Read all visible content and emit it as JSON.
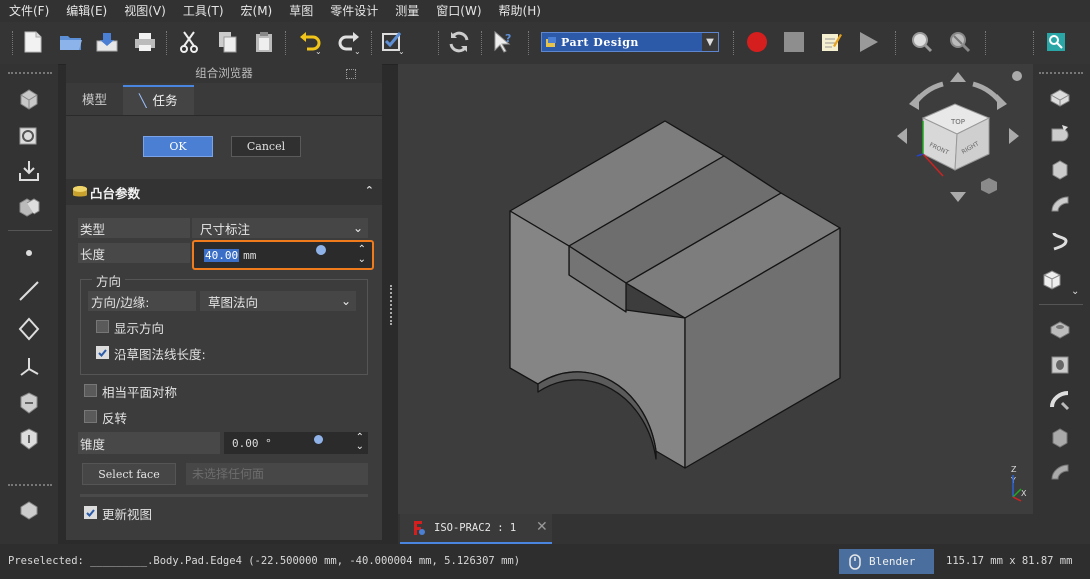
{
  "menu": [
    "文件(F)",
    "编辑(E)",
    "视图(V)",
    "工具(T)",
    "宏(M)",
    "草图",
    "零件设计",
    "测量",
    "窗口(W)",
    "帮助(H)"
  ],
  "toolbar": {
    "workbench": "Part Design",
    "icons": [
      "new-document-icon",
      "open-folder-icon",
      "save-icon",
      "print-icon",
      "cut-icon",
      "copy-icon",
      "paste-icon",
      "undo-icon",
      "redo-icon",
      "check-icon",
      "refresh-icon",
      "whats-this-icon",
      "record-macro-icon",
      "stop-macro-icon",
      "edit-macro-icon",
      "run-macro-icon",
      "measure-icon",
      "measure-settings-icon",
      "zoom-search-icon"
    ],
    "colors": {
      "record": "#d51f1f",
      "workbench_bg": "#2c5aa8"
    }
  },
  "panel": {
    "title": "组合浏览器",
    "tabs": [
      {
        "label": "模型"
      },
      {
        "label": "任务"
      }
    ],
    "ok_label": "OK",
    "cancel_label": "Cancel",
    "section_title": "凸台参数",
    "type_label": "类型",
    "type_value": "尺寸标注",
    "length_label": "长度",
    "length_value": "40.00",
    "length_unit": "mm",
    "direction_group": "方向",
    "direction_edge_label": "方向/边缘:",
    "direction_edge_value": "草图法向",
    "show_direction_label": "显示方向",
    "show_direction_checked": false,
    "along_normal_label": "沿草图法线长度:",
    "along_normal_checked": true,
    "symmetric_label": "相当平面对称",
    "symmetric_checked": false,
    "reversed_label": "反转",
    "reversed_checked": false,
    "taper_label": "锥度",
    "taper_value": "0.00 °",
    "select_face_label": "Select face",
    "face_placeholder": "未选择任何面",
    "update_view_label": "更新视图",
    "update_view_checked": true,
    "highlight_color": "#f07b1c"
  },
  "view_tab": {
    "label": "ISO-PRAC2 : 1"
  },
  "navcube": {
    "faces": [
      "TOP",
      "FRONT",
      "RIGHT"
    ]
  },
  "axis_labels": [
    "Z",
    "Y",
    "X"
  ],
  "status": {
    "preselected": "Preselected: _________.Body.Pad.Edge4 (-22.500000 mm, -40.000004 mm, 5.126307 mm)",
    "nav_style": "Blender",
    "dimensions": "115.17 mm x 81.87 mm"
  }
}
